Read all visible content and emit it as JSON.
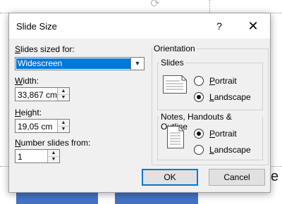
{
  "dialog": {
    "title": "Slide Size",
    "help_glyph": "?",
    "close_glyph": "✕"
  },
  "slides_sized_for": {
    "label_key": "S",
    "label_rest": "lides sized for:",
    "value": "Widescreen"
  },
  "width": {
    "label_key": "W",
    "label_rest": "idth:",
    "value": "33,867 cm"
  },
  "height": {
    "label_key": "H",
    "label_rest": "eight:",
    "value": "19,05 cm"
  },
  "number_from": {
    "label_key": "N",
    "label_rest": "umber slides from:",
    "value": "1"
  },
  "orientation": {
    "title": "Orientation",
    "slides": {
      "title": "Slides",
      "portrait_key": "P",
      "portrait_rest": "ortrait",
      "landscape_key": "L",
      "landscape_rest": "andscape",
      "selected": "landscape"
    },
    "notes": {
      "title": "Notes, Handouts & Outline",
      "portrait_key": "P",
      "portrait_rest": "ortrait",
      "landscape_key": "L",
      "landscape_rest": "andscape",
      "selected": "portrait"
    }
  },
  "buttons": {
    "ok": "OK",
    "cancel": "Cancel"
  },
  "background": {
    "partial_text": "e"
  }
}
